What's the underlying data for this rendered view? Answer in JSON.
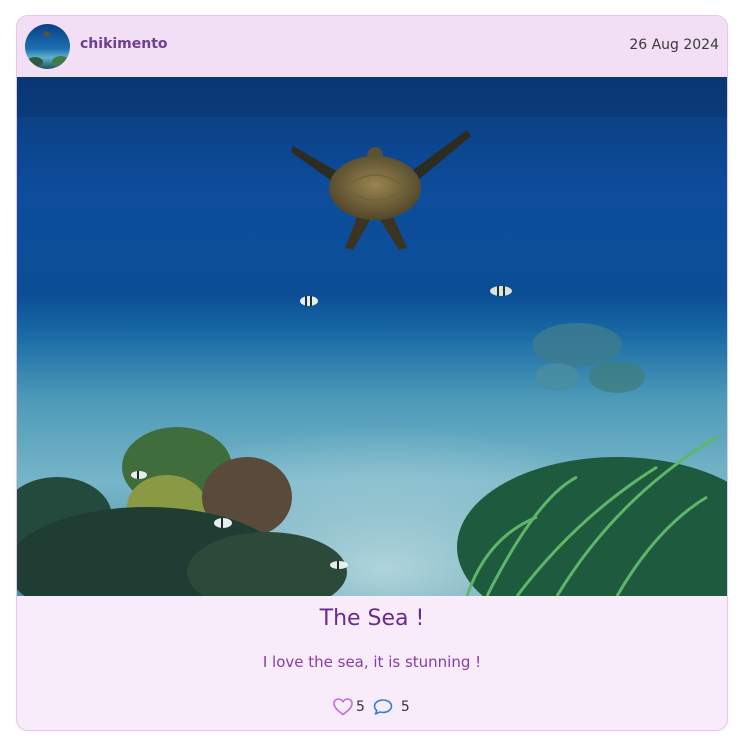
{
  "post": {
    "username": "chikimento",
    "date": "26 Aug 2024",
    "title": "The Sea !",
    "text": "I love the sea, it is stunning !",
    "likes": "5",
    "comments": "5"
  },
  "icons": {
    "like": "heart-icon",
    "comment": "speech-bubble-icon"
  },
  "colors": {
    "header_bg": "#f3dff5",
    "card_bg": "#f8ecfb",
    "accent_purple": "#6a2a8f",
    "heart_pink": "#c46bd6",
    "comment_blue": "#2f7fd6"
  }
}
